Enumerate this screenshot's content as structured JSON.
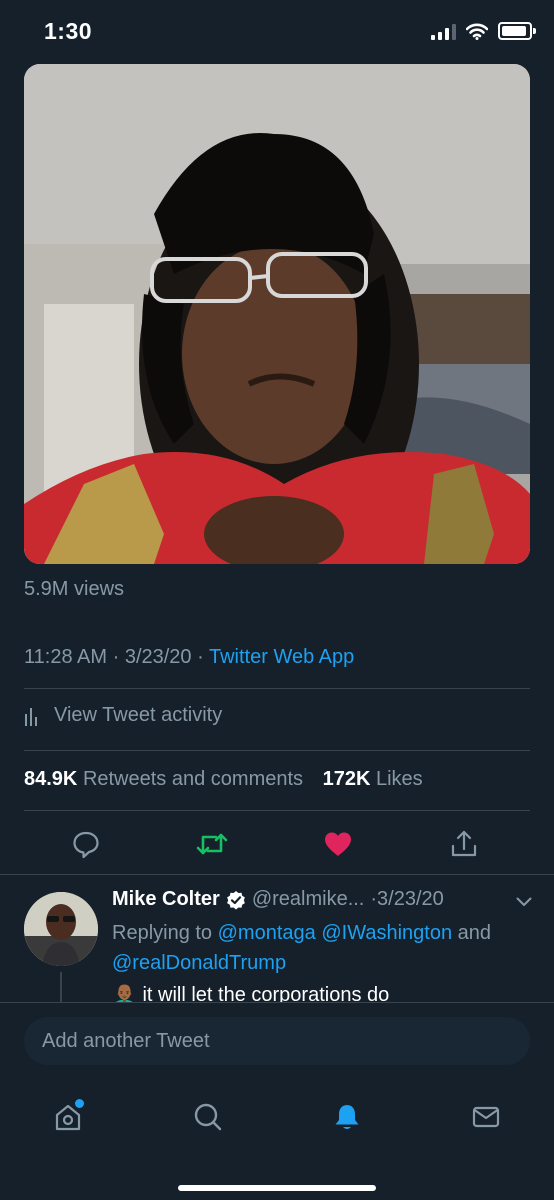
{
  "status_bar": {
    "time": "1:30"
  },
  "tweet": {
    "views": "5.9M views",
    "time": "11:28 AM",
    "date": "3/23/20",
    "separator": "·",
    "source": "Twitter Web App",
    "activity_label": "View Tweet activity",
    "retweets_count": "84.9K",
    "retweets_label": "Retweets and comments",
    "likes_count": "172K",
    "likes_label": "Likes"
  },
  "reply": {
    "name": "Mike Colter",
    "handle": "@realmike...",
    "date": "·3/23/20",
    "replying_prefix": "Replying to",
    "mention_1": "@montaga",
    "mention_2": "@IWashington",
    "and": "and",
    "mention_3": "@realDonaldTrump",
    "emoji": "👨🏾‍🦲",
    "text": "it will let the corporations do"
  },
  "compose": {
    "placeholder": "Add another Tweet"
  },
  "colors": {
    "background": "#15202b",
    "accent": "#1da1f2",
    "retweet_active": "#17bf63",
    "like_active": "#e0245e",
    "secondary_text": "#8899a6"
  },
  "icons": [
    "reply-icon",
    "retweet-icon",
    "like-icon",
    "share-icon",
    "verified-icon",
    "chevron-down-icon",
    "activity-icon",
    "home-icon",
    "search-icon",
    "notifications-icon",
    "messages-icon"
  ]
}
